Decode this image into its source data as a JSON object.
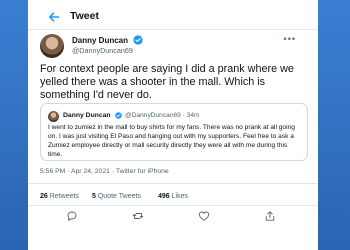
{
  "header": {
    "title": "Tweet"
  },
  "tweet": {
    "author_name": "Danny Duncan",
    "author_handle": "@DannyDuncan69",
    "text": "For context people are saying I did a prank where we yelled there was a shooter in the mall. Which is something I'd never do.",
    "quoted": {
      "author_name": "Danny Duncan",
      "author_handle": "@DannyDuncan69 · 34m",
      "text": "I went to zumiez in the mall to buy shirts for my fans. There was no prank at all going on. I was just visiting El Paso and hanging out with my supporters. Feel free to ask a Zumiez employee directly or mall security directly they were all with me during this time."
    },
    "timestamp": "5:56 PM · Apr 24, 2021 · Twitter for iPhone",
    "stats": {
      "retweets": {
        "count": "26",
        "label": "Retweets"
      },
      "quote_tweets": {
        "count": "5",
        "label": "Quote Tweets"
      },
      "likes": {
        "count": "496",
        "label": "Likes"
      }
    }
  },
  "colors": {
    "accent": "#1d9bf0",
    "background": "#2f6fc3"
  },
  "icons": [
    "back-arrow-icon",
    "verified-icon",
    "more-icon",
    "reply-icon",
    "retweet-icon",
    "like-icon",
    "share-icon"
  ]
}
